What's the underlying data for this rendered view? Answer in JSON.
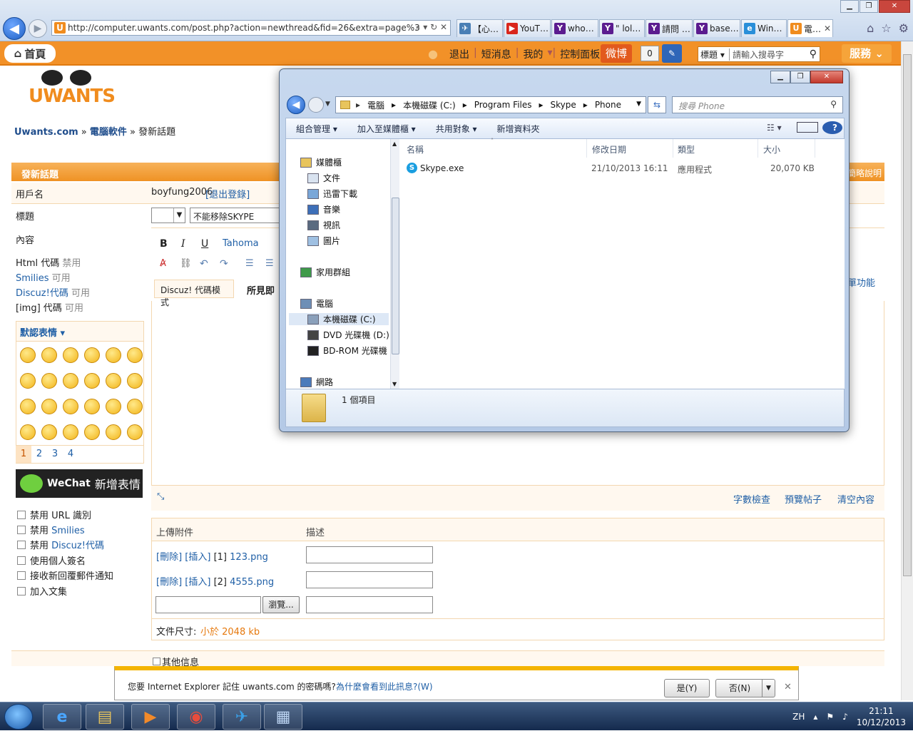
{
  "browser": {
    "url": "http://computer.uwants.com/post.php?action=newthread&fid=26&extra=page%3",
    "tabs": [
      {
        "label": "【心…",
        "icon": "bird"
      },
      {
        "label": "YouT…",
        "icon": "youtube"
      },
      {
        "label": "who…",
        "icon": "yahoo"
      },
      {
        "label": "\" lol…",
        "icon": "yahoo"
      },
      {
        "label": "請問 …",
        "icon": "yahoo"
      },
      {
        "label": "base…",
        "icon": "yahoo"
      },
      {
        "label": "Win…",
        "icon": "ie"
      },
      {
        "label": "電…",
        "icon": "uwants"
      }
    ]
  },
  "site": {
    "home_label": "首頁",
    "top_links": [
      "退出",
      "短消息",
      "我的",
      "控制面板"
    ],
    "weibo_label": "微博",
    "notif_count": "0",
    "search_select": "標題",
    "search_placeholder": "請輸入搜尋字",
    "service_label": "服務",
    "logo_text": "UWANTS",
    "breadcrumb": {
      "site": "Uwants.com",
      "sep1": " » ",
      "forum": "電腦軟件",
      "sep2": " » ",
      "page": "發新話題"
    }
  },
  "form": {
    "title": "發新話題",
    "help_link": "簡略說明",
    "username_label": "用戶名",
    "username_value": "boyfung2006",
    "logout_link": "[退出登錄]",
    "subject_label": "標題",
    "subject_value": "不能移除SKYPE",
    "content_label": "內容",
    "html_code": "Html 代碼",
    "html_status": "禁用",
    "smilies_label": "Smilies",
    "smilies_status": "可用",
    "discuz_label": "Discuz!代碼",
    "discuz_status": "可用",
    "img_label": "[img] 代碼",
    "img_status": "可用",
    "default_emotes": "默認表情",
    "emote_pages": [
      "1",
      "2",
      "3",
      "4"
    ],
    "wechat_label": "WeChat",
    "wechat_add": "新增表情",
    "options": [
      {
        "label": "禁用 URL 識別",
        "link": ""
      },
      {
        "label": "禁用 ",
        "link": "Smilies"
      },
      {
        "label": "禁用 ",
        "link": "Discuz!代碼"
      },
      {
        "label": "使用個人簽名",
        "link": ""
      },
      {
        "label": "接收新回覆郵件通知",
        "link": ""
      },
      {
        "label": "加入文集",
        "link": ""
      }
    ],
    "font_name": "Tahoma",
    "mode_discuz": "Discuz! 代碼模式",
    "mode_wysiwyg": "所見即",
    "simple_func": "單功能",
    "word_check": "字數檢查",
    "preview": "預覽帖子",
    "clear": "清空內容",
    "upload_label": "上傳附件",
    "desc_label": "描述",
    "attachments": [
      {
        "del": "[刪除]",
        "ins": "[插入]",
        "idx": "[1]",
        "file": "123.png"
      },
      {
        "del": "[刪除]",
        "ins": "[插入]",
        "idx": "[2]",
        "file": "4555.png"
      }
    ],
    "browse_btn": "瀏覽...",
    "filesize_label": "文件尺寸:",
    "filesize_value": "小於 2048 kb",
    "other_info": "其他信息"
  },
  "explorer": {
    "path": [
      "電腦",
      "本機磁碟 (C:)",
      "Program Files",
      "Skype",
      "Phone"
    ],
    "search_placeholder": "搜尋 Phone",
    "commands": [
      "組合管理 ▾",
      "加入至媒體櫃 ▾",
      "共用對象 ▾",
      "新增資料夾"
    ],
    "nav": [
      {
        "label": "媒體櫃",
        "indent": 0
      },
      {
        "label": "文件",
        "indent": 1
      },
      {
        "label": "迅雷下載",
        "indent": 1
      },
      {
        "label": "音樂",
        "indent": 1
      },
      {
        "label": "視訊",
        "indent": 1
      },
      {
        "label": "圖片",
        "indent": 1
      },
      {
        "label": "家用群組",
        "indent": 0
      },
      {
        "label": "電腦",
        "indent": 0
      },
      {
        "label": "本機磁碟 (C:)",
        "indent": 1
      },
      {
        "label": "DVD 光碟機 (D:)",
        "indent": 1
      },
      {
        "label": "BD-ROM 光碟機",
        "indent": 1
      },
      {
        "label": "網路",
        "indent": 0
      }
    ],
    "columns": [
      "名稱",
      "修改日期",
      "類型",
      "大小"
    ],
    "files": [
      {
        "name": "Skype.exe",
        "date": "21/10/2013 16:11",
        "type": "應用程式",
        "size": "20,070 KB"
      }
    ],
    "status": "1 個項目"
  },
  "notification": {
    "message": "您要 Internet Explorer 記住 uwants.com 的密碼嗎?",
    "why_link": "為什麼會看到此訊息?(W)",
    "yes": "是(Y)",
    "no": "否(N)"
  },
  "taskbar": {
    "lang": "ZH",
    "time": "21:11",
    "date": "10/12/2013"
  }
}
